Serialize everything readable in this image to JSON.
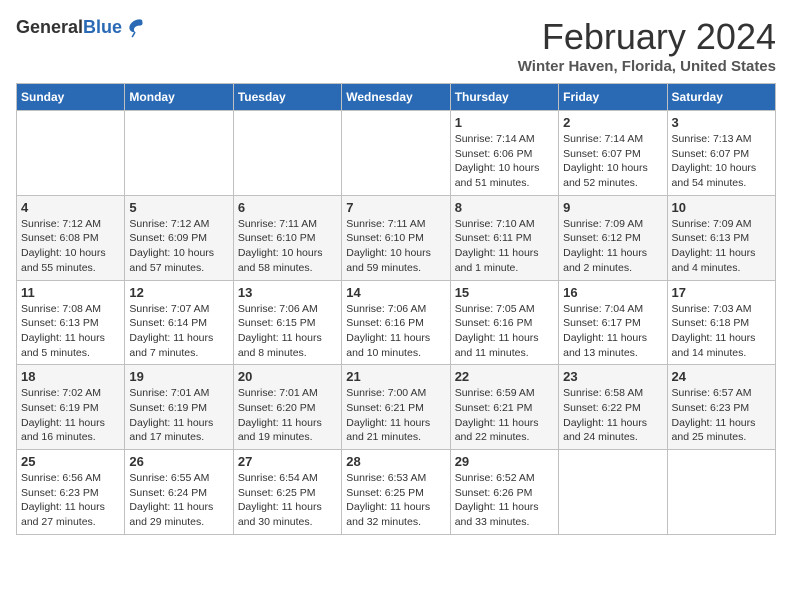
{
  "header": {
    "logo_general": "General",
    "logo_blue": "Blue",
    "month_title": "February 2024",
    "location": "Winter Haven, Florida, United States"
  },
  "days_of_week": [
    "Sunday",
    "Monday",
    "Tuesday",
    "Wednesday",
    "Thursday",
    "Friday",
    "Saturday"
  ],
  "weeks": [
    [
      {
        "day": "",
        "info": ""
      },
      {
        "day": "",
        "info": ""
      },
      {
        "day": "",
        "info": ""
      },
      {
        "day": "",
        "info": ""
      },
      {
        "day": "1",
        "info": "Sunrise: 7:14 AM\nSunset: 6:06 PM\nDaylight: 10 hours\nand 51 minutes."
      },
      {
        "day": "2",
        "info": "Sunrise: 7:14 AM\nSunset: 6:07 PM\nDaylight: 10 hours\nand 52 minutes."
      },
      {
        "day": "3",
        "info": "Sunrise: 7:13 AM\nSunset: 6:07 PM\nDaylight: 10 hours\nand 54 minutes."
      }
    ],
    [
      {
        "day": "4",
        "info": "Sunrise: 7:12 AM\nSunset: 6:08 PM\nDaylight: 10 hours\nand 55 minutes."
      },
      {
        "day": "5",
        "info": "Sunrise: 7:12 AM\nSunset: 6:09 PM\nDaylight: 10 hours\nand 57 minutes."
      },
      {
        "day": "6",
        "info": "Sunrise: 7:11 AM\nSunset: 6:10 PM\nDaylight: 10 hours\nand 58 minutes."
      },
      {
        "day": "7",
        "info": "Sunrise: 7:11 AM\nSunset: 6:10 PM\nDaylight: 10 hours\nand 59 minutes."
      },
      {
        "day": "8",
        "info": "Sunrise: 7:10 AM\nSunset: 6:11 PM\nDaylight: 11 hours\nand 1 minute."
      },
      {
        "day": "9",
        "info": "Sunrise: 7:09 AM\nSunset: 6:12 PM\nDaylight: 11 hours\nand 2 minutes."
      },
      {
        "day": "10",
        "info": "Sunrise: 7:09 AM\nSunset: 6:13 PM\nDaylight: 11 hours\nand 4 minutes."
      }
    ],
    [
      {
        "day": "11",
        "info": "Sunrise: 7:08 AM\nSunset: 6:13 PM\nDaylight: 11 hours\nand 5 minutes."
      },
      {
        "day": "12",
        "info": "Sunrise: 7:07 AM\nSunset: 6:14 PM\nDaylight: 11 hours\nand 7 minutes."
      },
      {
        "day": "13",
        "info": "Sunrise: 7:06 AM\nSunset: 6:15 PM\nDaylight: 11 hours\nand 8 minutes."
      },
      {
        "day": "14",
        "info": "Sunrise: 7:06 AM\nSunset: 6:16 PM\nDaylight: 11 hours\nand 10 minutes."
      },
      {
        "day": "15",
        "info": "Sunrise: 7:05 AM\nSunset: 6:16 PM\nDaylight: 11 hours\nand 11 minutes."
      },
      {
        "day": "16",
        "info": "Sunrise: 7:04 AM\nSunset: 6:17 PM\nDaylight: 11 hours\nand 13 minutes."
      },
      {
        "day": "17",
        "info": "Sunrise: 7:03 AM\nSunset: 6:18 PM\nDaylight: 11 hours\nand 14 minutes."
      }
    ],
    [
      {
        "day": "18",
        "info": "Sunrise: 7:02 AM\nSunset: 6:19 PM\nDaylight: 11 hours\nand 16 minutes."
      },
      {
        "day": "19",
        "info": "Sunrise: 7:01 AM\nSunset: 6:19 PM\nDaylight: 11 hours\nand 17 minutes."
      },
      {
        "day": "20",
        "info": "Sunrise: 7:01 AM\nSunset: 6:20 PM\nDaylight: 11 hours\nand 19 minutes."
      },
      {
        "day": "21",
        "info": "Sunrise: 7:00 AM\nSunset: 6:21 PM\nDaylight: 11 hours\nand 21 minutes."
      },
      {
        "day": "22",
        "info": "Sunrise: 6:59 AM\nSunset: 6:21 PM\nDaylight: 11 hours\nand 22 minutes."
      },
      {
        "day": "23",
        "info": "Sunrise: 6:58 AM\nSunset: 6:22 PM\nDaylight: 11 hours\nand 24 minutes."
      },
      {
        "day": "24",
        "info": "Sunrise: 6:57 AM\nSunset: 6:23 PM\nDaylight: 11 hours\nand 25 minutes."
      }
    ],
    [
      {
        "day": "25",
        "info": "Sunrise: 6:56 AM\nSunset: 6:23 PM\nDaylight: 11 hours\nand 27 minutes."
      },
      {
        "day": "26",
        "info": "Sunrise: 6:55 AM\nSunset: 6:24 PM\nDaylight: 11 hours\nand 29 minutes."
      },
      {
        "day": "27",
        "info": "Sunrise: 6:54 AM\nSunset: 6:25 PM\nDaylight: 11 hours\nand 30 minutes."
      },
      {
        "day": "28",
        "info": "Sunrise: 6:53 AM\nSunset: 6:25 PM\nDaylight: 11 hours\nand 32 minutes."
      },
      {
        "day": "29",
        "info": "Sunrise: 6:52 AM\nSunset: 6:26 PM\nDaylight: 11 hours\nand 33 minutes."
      },
      {
        "day": "",
        "info": ""
      },
      {
        "day": "",
        "info": ""
      }
    ]
  ]
}
